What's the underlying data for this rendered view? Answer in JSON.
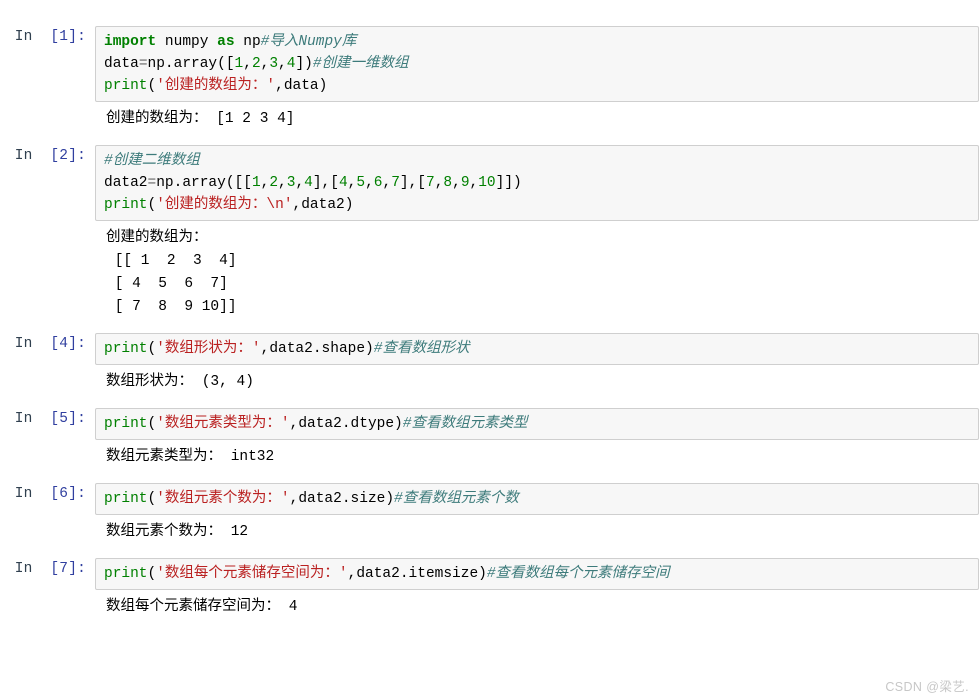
{
  "notebook": {
    "watermark": "CSDN @梁艺.",
    "cells": [
      {
        "prompt_label": "In",
        "prompt_count": "[1]:",
        "code_lines": [
          [
            {
              "t": "import",
              "c": "k"
            },
            {
              "t": " numpy ",
              "c": "p"
            },
            {
              "t": "as",
              "c": "k"
            },
            {
              "t": " np",
              "c": "p"
            },
            {
              "t": "#导入Numpy库",
              "c": "c"
            }
          ],
          [
            {
              "t": "data",
              "c": "p"
            },
            {
              "t": "=",
              "c": "o"
            },
            {
              "t": "np.array([",
              "c": "p"
            },
            {
              "t": "1",
              "c": "m"
            },
            {
              "t": ",",
              "c": "p"
            },
            {
              "t": "2",
              "c": "m"
            },
            {
              "t": ",",
              "c": "p"
            },
            {
              "t": "3",
              "c": "m"
            },
            {
              "t": ",",
              "c": "p"
            },
            {
              "t": "4",
              "c": "m"
            },
            {
              "t": "])",
              "c": "p"
            },
            {
              "t": "#创建一维数组",
              "c": "c"
            }
          ],
          [
            {
              "t": "print",
              "c": "nb"
            },
            {
              "t": "(",
              "c": "p"
            },
            {
              "t": "'创建的数组为：'",
              "c": "s"
            },
            {
              "t": ",data)",
              "c": "p"
            }
          ]
        ],
        "output_lines": [
          "创建的数组为： [1 2 3 4]"
        ]
      },
      {
        "prompt_label": "In",
        "prompt_count": "[2]:",
        "code_lines": [
          [
            {
              "t": "#创建二维数组",
              "c": "c"
            }
          ],
          [
            {
              "t": "data2",
              "c": "p"
            },
            {
              "t": "=",
              "c": "o"
            },
            {
              "t": "np.array([[",
              "c": "p"
            },
            {
              "t": "1",
              "c": "m"
            },
            {
              "t": ",",
              "c": "p"
            },
            {
              "t": "2",
              "c": "m"
            },
            {
              "t": ",",
              "c": "p"
            },
            {
              "t": "3",
              "c": "m"
            },
            {
              "t": ",",
              "c": "p"
            },
            {
              "t": "4",
              "c": "m"
            },
            {
              "t": "],[",
              "c": "p"
            },
            {
              "t": "4",
              "c": "m"
            },
            {
              "t": ",",
              "c": "p"
            },
            {
              "t": "5",
              "c": "m"
            },
            {
              "t": ",",
              "c": "p"
            },
            {
              "t": "6",
              "c": "m"
            },
            {
              "t": ",",
              "c": "p"
            },
            {
              "t": "7",
              "c": "m"
            },
            {
              "t": "],[",
              "c": "p"
            },
            {
              "t": "7",
              "c": "m"
            },
            {
              "t": ",",
              "c": "p"
            },
            {
              "t": "8",
              "c": "m"
            },
            {
              "t": ",",
              "c": "p"
            },
            {
              "t": "9",
              "c": "m"
            },
            {
              "t": ",",
              "c": "p"
            },
            {
              "t": "10",
              "c": "m"
            },
            {
              "t": "]])",
              "c": "p"
            }
          ],
          [
            {
              "t": "print",
              "c": "nb"
            },
            {
              "t": "(",
              "c": "p"
            },
            {
              "t": "'创建的数组为：\\n'",
              "c": "s"
            },
            {
              "t": ",data2)",
              "c": "p"
            }
          ]
        ],
        "output_lines": [
          "创建的数组为：",
          " [[ 1  2  3  4]",
          " [ 4  5  6  7]",
          " [ 7  8  9 10]]"
        ]
      },
      {
        "prompt_label": "In",
        "prompt_count": "[4]:",
        "code_lines": [
          [
            {
              "t": "print",
              "c": "nb"
            },
            {
              "t": "(",
              "c": "p"
            },
            {
              "t": "'数组形状为：'",
              "c": "s"
            },
            {
              "t": ",data2.shape)",
              "c": "p"
            },
            {
              "t": "#查看数组形状",
              "c": "c"
            }
          ]
        ],
        "output_lines": [
          "数组形状为： (3, 4)"
        ]
      },
      {
        "prompt_label": "In",
        "prompt_count": "[5]:",
        "code_lines": [
          [
            {
              "t": "print",
              "c": "nb"
            },
            {
              "t": "(",
              "c": "p"
            },
            {
              "t": "'数组元素类型为：'",
              "c": "s"
            },
            {
              "t": ",data2.dtype)",
              "c": "p"
            },
            {
              "t": "#查看数组元素类型",
              "c": "c"
            }
          ]
        ],
        "output_lines": [
          "数组元素类型为： int32"
        ]
      },
      {
        "prompt_label": "In",
        "prompt_count": "[6]:",
        "code_lines": [
          [
            {
              "t": "print",
              "c": "nb"
            },
            {
              "t": "(",
              "c": "p"
            },
            {
              "t": "'数组元素个数为：'",
              "c": "s"
            },
            {
              "t": ",data2.size)",
              "c": "p"
            },
            {
              "t": "#查看数组元素个数",
              "c": "c"
            }
          ]
        ],
        "output_lines": [
          "数组元素个数为： 12"
        ]
      },
      {
        "prompt_label": "In",
        "prompt_count": "[7]:",
        "code_lines": [
          [
            {
              "t": "print",
              "c": "nb"
            },
            {
              "t": "(",
              "c": "p"
            },
            {
              "t": "'数组每个元素储存空间为：'",
              "c": "s"
            },
            {
              "t": ",data2.itemsize)",
              "c": "p"
            },
            {
              "t": "#查看数组每个元素储存空间",
              "c": "c"
            }
          ]
        ],
        "output_lines": [
          "数组每个元素储存空间为： 4"
        ]
      }
    ]
  }
}
